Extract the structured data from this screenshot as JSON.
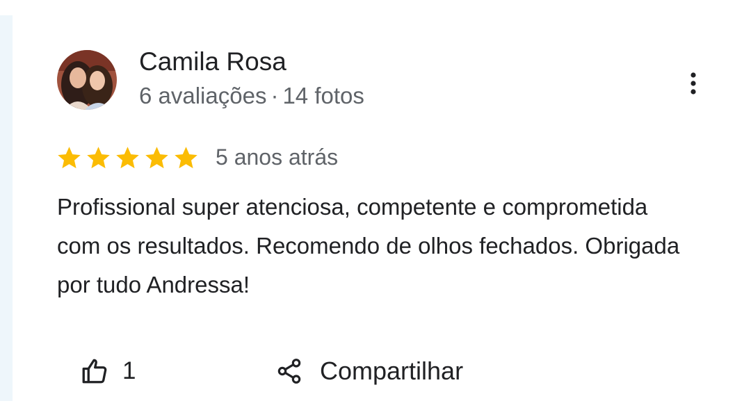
{
  "review": {
    "reviewer": {
      "name": "Camila Rosa",
      "reviews_count": "6 avaliações",
      "separator": "·",
      "photos_count": "14 fotos"
    },
    "rating": 5,
    "max_rating": 5,
    "star_color": "#fbbc04",
    "age": "5 anos atrás",
    "text": "Profissional super atenciosa, competente e comprometida com os resultados. Recomendo de olhos fechados. Obrigada por tudo Andressa!",
    "actions": {
      "like_count": "1",
      "share_label": "Compartilhar"
    },
    "icons": {
      "more": "more-vert-icon",
      "like": "thumb-up-icon",
      "share": "share-icon"
    }
  }
}
